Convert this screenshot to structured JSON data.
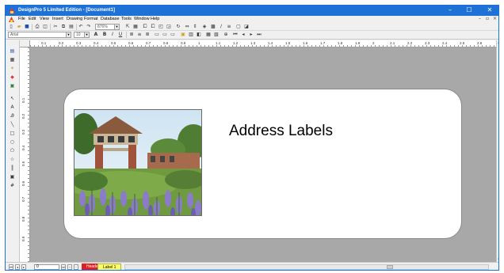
{
  "window": {
    "title": "DesignPro 5 Limited Edition - [Document1]",
    "controls": {
      "minimize": "–",
      "maximize": "☐",
      "close": "✕"
    }
  },
  "menubar": {
    "items": [
      "File",
      "Edit",
      "View",
      "Insert",
      "Drawing",
      "Format",
      "Database",
      "Tools",
      "Window",
      "Help"
    ],
    "mdi_controls": {
      "minimize": "–",
      "restore": "▫",
      "close": "×"
    }
  },
  "toolbar": {
    "zoom_value": "876%",
    "font_name": "Arial",
    "font_size": "10",
    "bold": "B",
    "italic": "I",
    "underline": "U",
    "text_color": "A"
  },
  "ruler": {
    "h_labels": [
      "0.1",
      "0.2",
      "0.3",
      "0.4",
      "0.5",
      "0.6",
      "0.7",
      "0.8",
      "0.9",
      "1",
      "1.1",
      "1.2",
      "1.3",
      "1.4",
      "1.5",
      "1.6",
      "1.7",
      "1.8",
      "1.9",
      "2",
      "2.1",
      "2.2",
      "2.3",
      "2.4",
      "2.5",
      "2.6"
    ],
    "v_labels": [
      "0.1",
      "0.2",
      "0.3",
      "0.4",
      "0.5",
      "0.6",
      "0.7",
      "0.8",
      "0.9"
    ]
  },
  "label": {
    "text": "Address Labels"
  },
  "statusbar": {
    "page_value": "0",
    "tabs": [
      "Header",
      "Label 1"
    ]
  },
  "colors": {
    "titlebar": "#1e72d6",
    "canvas": "#a8a8a8",
    "tab_active": "#e02020",
    "tab_inactive": "#ffff66"
  }
}
